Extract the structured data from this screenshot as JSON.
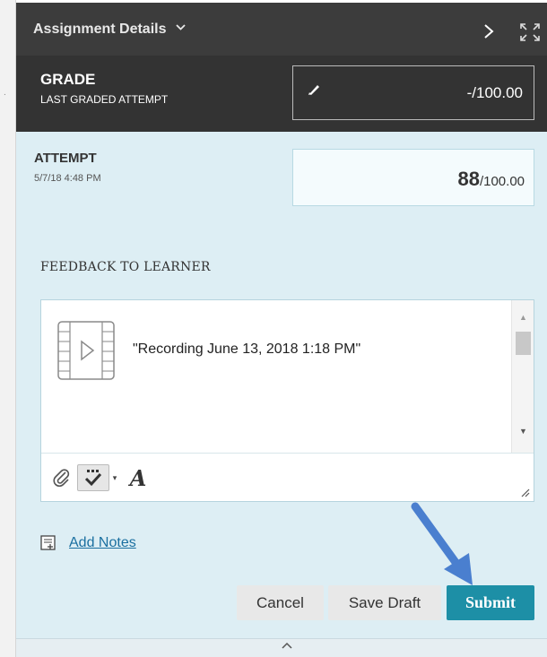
{
  "header": {
    "title": "Assignment Details",
    "dropdown_icon": "chevron-down-icon",
    "next_icon": "chevron-right-icon",
    "expand_icon": "expand-icon"
  },
  "grade": {
    "label": "GRADE",
    "sublabel": "LAST GRADED ATTEMPT",
    "value": "-/100.00",
    "edit_icon": "pencil-icon"
  },
  "attempt": {
    "label": "ATTEMPT",
    "date": "5/7/18 4:48 PM",
    "score": "88",
    "out_of": "/100.00"
  },
  "feedback": {
    "label": "FEEDBACK TO LEARNER",
    "content": "\"Recording June 13, 2018 1:18 PM\"",
    "media_icon": "video-file-icon",
    "toolbar": {
      "attach_icon": "paperclip-icon",
      "spellcheck_icon": "spellcheck-icon",
      "font_icon": "font-style-icon"
    }
  },
  "notes": {
    "label": "Add Notes",
    "icon": "notes-icon"
  },
  "buttons": {
    "cancel": "Cancel",
    "save_draft": "Save Draft",
    "submit": "Submit"
  },
  "colors": {
    "header_bg": "#3c3c3c",
    "grade_bg": "#333333",
    "panel_bg": "#ddeef4",
    "submit_bg": "#1d8fa6",
    "link": "#1a6fa0",
    "arrow": "#4a7fcf"
  }
}
